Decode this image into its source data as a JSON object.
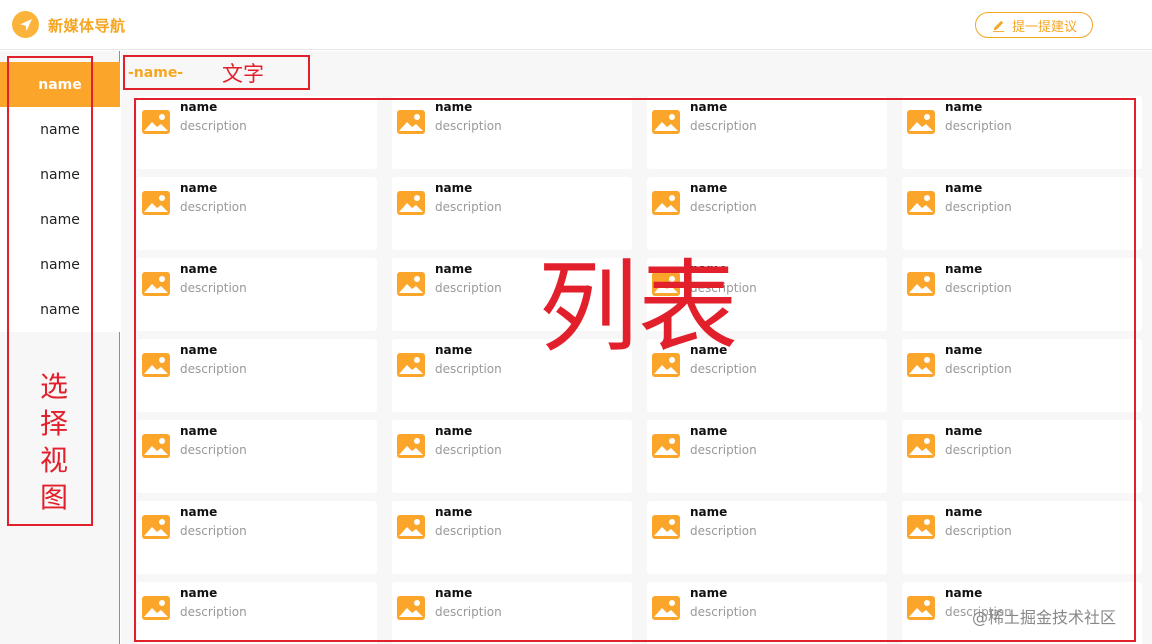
{
  "header": {
    "app_title": "新媒体导航",
    "suggest_label": "提一提建议",
    "accent": "#f5a623"
  },
  "sidebar": {
    "items": [
      {
        "label": "name",
        "active": true
      },
      {
        "label": "name",
        "active": false
      },
      {
        "label": "name",
        "active": false
      },
      {
        "label": "name",
        "active": false
      },
      {
        "label": "name",
        "active": false
      },
      {
        "label": "name",
        "active": false
      }
    ]
  },
  "main": {
    "section_title": "-name-",
    "cards": {
      "rows": 7,
      "cols": 4,
      "name": "name",
      "description": "description",
      "icon": "image-icon"
    }
  },
  "annotations": {
    "text_label": "文字",
    "list_label": "列表",
    "sidebar_label": "选择视图",
    "color": "#e2202c"
  },
  "watermark": "@稀土掘金技术社区"
}
